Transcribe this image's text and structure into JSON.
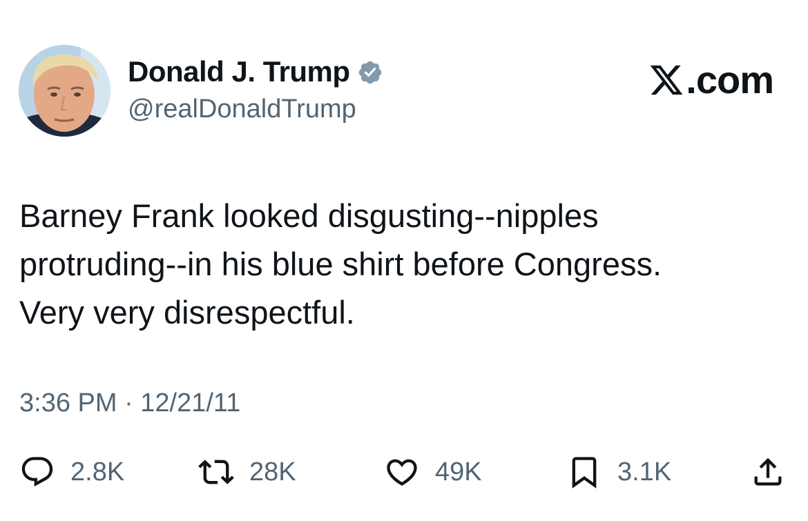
{
  "author": {
    "display_name": "Donald J. Trump",
    "handle": "@realDonaldTrump",
    "verified_badge": "verified-badge-icon",
    "verified_color": "#829aab"
  },
  "brand": {
    "logo": "x-logo-icon",
    "suffix": ".com"
  },
  "tweet": {
    "text": "Barney Frank looked disgusting--nipples\nprotruding--in his blue shirt before Congress.\nVery very disrespectful.",
    "timestamp": "3:36 PM · 12/21/11"
  },
  "actions": {
    "reply": {
      "icon": "reply-icon",
      "count": "2.8K"
    },
    "retweet": {
      "icon": "retweet-icon",
      "count": "28K"
    },
    "like": {
      "icon": "heart-icon",
      "count": "49K"
    },
    "bookmark": {
      "icon": "bookmark-icon",
      "count": "3.1K"
    },
    "share": {
      "icon": "share-icon"
    }
  },
  "colors": {
    "text_primary": "#0f1419",
    "text_secondary": "#536471",
    "background": "#ffffff"
  }
}
